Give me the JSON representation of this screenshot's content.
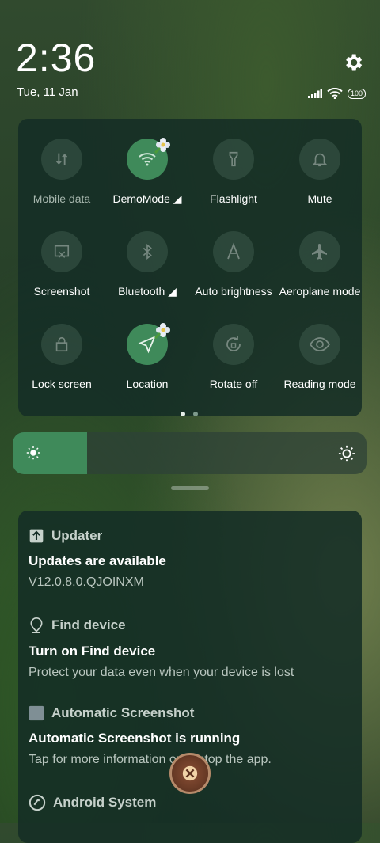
{
  "status": {
    "time": "2:36",
    "date": "Tue, 11 Jan",
    "battery": "100"
  },
  "quick_settings": {
    "tiles": [
      {
        "label": "Mobile data",
        "icon": "mobile-data-icon",
        "state": "off"
      },
      {
        "label": "DemoMode ◢",
        "icon": "wifi-icon",
        "state": "on"
      },
      {
        "label": "Flashlight",
        "icon": "flashlight-icon",
        "state": "off"
      },
      {
        "label": "Mute",
        "icon": "bell-icon",
        "state": "off"
      },
      {
        "label": "Screenshot",
        "icon": "screenshot-icon",
        "state": "off"
      },
      {
        "label": "Bluetooth ◢",
        "icon": "bluetooth-icon",
        "state": "off"
      },
      {
        "label": "Auto brightness",
        "icon": "auto-brightness-icon",
        "state": "off"
      },
      {
        "label": "Aeroplane mode",
        "icon": "airplane-icon",
        "state": "off"
      },
      {
        "label": "Lock screen",
        "icon": "lock-icon",
        "state": "off"
      },
      {
        "label": "Location",
        "icon": "location-icon",
        "state": "on"
      },
      {
        "label": "Rotate off",
        "icon": "rotate-icon",
        "state": "off"
      },
      {
        "label": "Reading mode",
        "icon": "eye-icon",
        "state": "off"
      }
    ],
    "page_indicator": {
      "pages": 2,
      "current": 1
    }
  },
  "brightness": {
    "level": 0.21
  },
  "notifications": [
    {
      "app": "Updater",
      "icon": "upload-icon",
      "title": "Updates are available",
      "body": "V12.0.8.0.QJOINXM"
    },
    {
      "app": "Find device",
      "icon": "map-pin-icon",
      "title": "Turn on Find device",
      "body": "Protect your data even when your device is lost"
    },
    {
      "app": "Automatic Screenshot",
      "icon": "square-icon",
      "title": "Automatic Screenshot is running",
      "body": "Tap for more information or to stop the app."
    },
    {
      "app": "Android System",
      "icon": "android-system-icon",
      "title": "",
      "body": ""
    }
  ],
  "colors": {
    "accent": "#3f8a5a",
    "panel": "#142d26"
  }
}
